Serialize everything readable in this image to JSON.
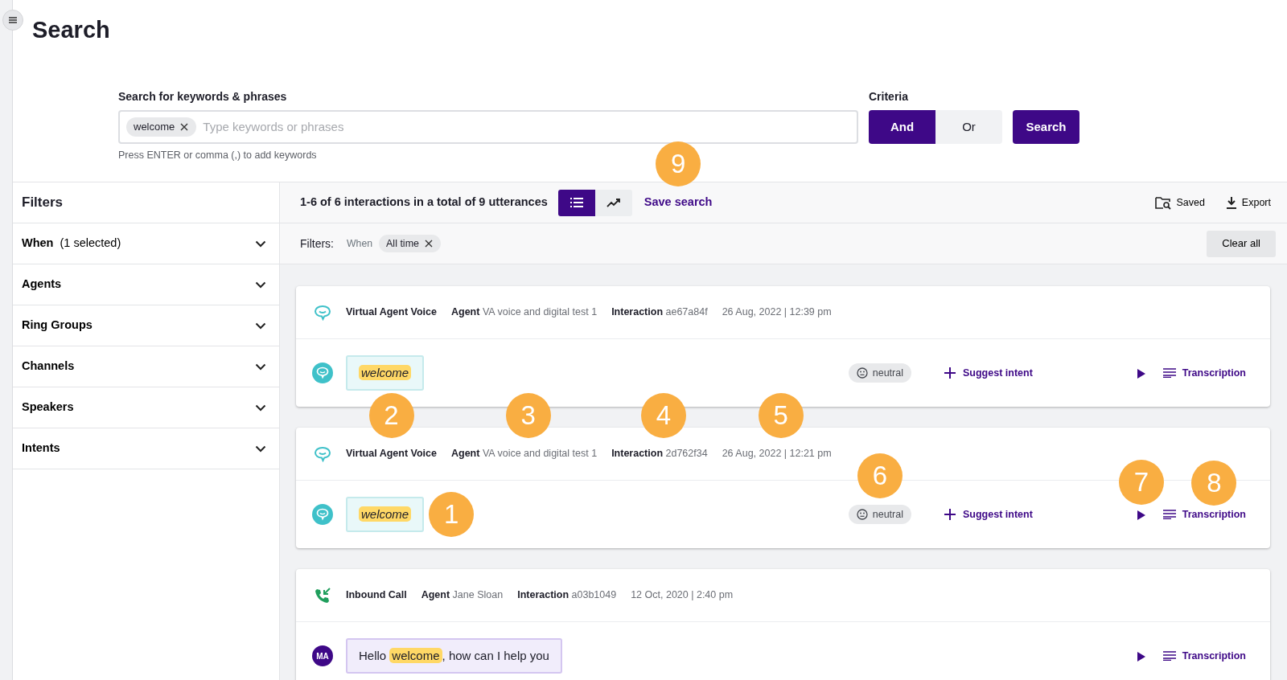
{
  "page": {
    "title": "Search"
  },
  "search": {
    "label": "Search for keywords & phrases",
    "keywords": [
      "welcome"
    ],
    "placeholder": "Type keywords or phrases",
    "hint": "Press ENTER or comma (,) to add keywords",
    "criteria_label": "Criteria",
    "criteria": [
      {
        "label": "And",
        "selected": true
      },
      {
        "label": "Or",
        "selected": false
      }
    ],
    "submit": "Search"
  },
  "filters": {
    "title": "Filters",
    "items": [
      {
        "label": "When",
        "note": "(1 selected)"
      },
      {
        "label": "Agents"
      },
      {
        "label": "Ring Groups"
      },
      {
        "label": "Channels"
      },
      {
        "label": "Speakers"
      },
      {
        "label": "Intents"
      }
    ]
  },
  "results": {
    "summary": "1-6 of 6 interactions in a total of 9 utterances",
    "views": [
      {
        "kind": "list",
        "selected": true
      },
      {
        "kind": "trend",
        "selected": false
      }
    ],
    "save": "Save search",
    "saved": "Saved",
    "export": "Export",
    "filter_label": "Filters:",
    "active_filters": [
      {
        "field": "When",
        "value": "All time"
      }
    ],
    "clear": "Clear all",
    "cards": [
      {
        "kind": "virtual",
        "channel": "Virtual Agent Voice",
        "agent_label": "Agent",
        "agent": "VA voice and digital test 1",
        "interaction_label": "Interaction",
        "interaction": "ae67a84f",
        "datetime": "26 Aug, 2022 | 12:39 pm",
        "avatar": {
          "kind": "bot"
        },
        "utterance": [
          {
            "text": "welcome",
            "highlight": true
          }
        ],
        "sentiment": "neutral",
        "suggest": "Suggest intent",
        "transcription": "Transcription"
      },
      {
        "kind": "virtual",
        "channel": "Virtual Agent Voice",
        "agent_label": "Agent",
        "agent": "VA voice and digital test 1",
        "interaction_label": "Interaction",
        "interaction": "2d762f34",
        "datetime": "26 Aug, 2022 | 12:21 pm",
        "avatar": {
          "kind": "bot"
        },
        "utterance": [
          {
            "text": "welcome",
            "highlight": true
          }
        ],
        "sentiment": "neutral",
        "suggest": "Suggest intent",
        "transcription": "Transcription"
      },
      {
        "kind": "inbound",
        "channel": "Inbound Call",
        "agent_label": "Agent",
        "agent": "Jane Sloan",
        "interaction_label": "Interaction",
        "interaction": "a03b1049",
        "datetime": "12 Oct, 2020 | 2:40 pm",
        "avatar": {
          "kind": "initials",
          "initials": "MA"
        },
        "utterance": [
          {
            "text": "Hello ",
            "highlight": false
          },
          {
            "text": "welcome",
            "highlight": true
          },
          {
            "text": ", how can I help you",
            "highlight": false
          }
        ],
        "transcription": "Transcription"
      }
    ]
  },
  "callouts": [
    {
      "label": "9"
    },
    {
      "label": "2"
    },
    {
      "label": "3"
    },
    {
      "label": "4"
    },
    {
      "label": "5"
    },
    {
      "label": "6"
    },
    {
      "label": "1"
    },
    {
      "label": "7"
    },
    {
      "label": "8"
    }
  ]
}
